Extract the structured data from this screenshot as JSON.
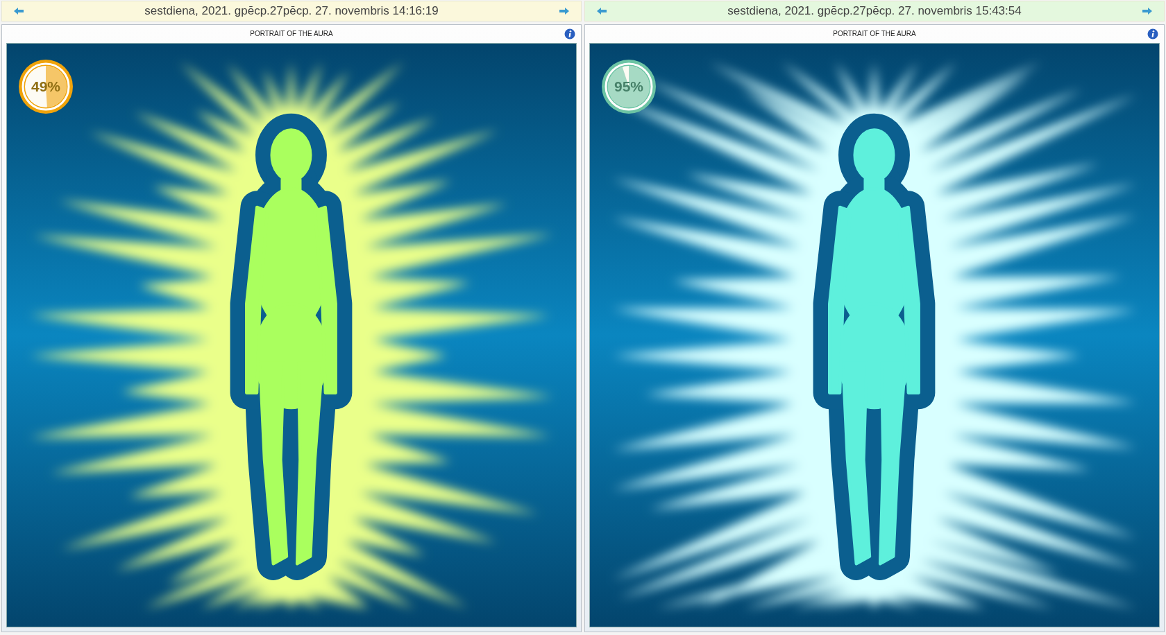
{
  "panels": [
    {
      "header": {
        "date": "sestdiena, 2021. gpēcp.27pēcp. 27. novembris 14:16:19",
        "color": "#fbf8dc"
      },
      "title": "PORTRAIT OF THE AURA",
      "badge": {
        "value": "49%",
        "level": 0.49,
        "color": "#f0a30a"
      },
      "aura": {
        "color": "#eaff8a"
      },
      "figure": {
        "color": "#aaff5e"
      }
    },
    {
      "header": {
        "date": "sestdiena, 2021. gpēcp.27pēcp. 27. novembris 15:43:54",
        "color": "#e4f8de"
      },
      "title": "PORTRAIT OF THE AURA",
      "badge": {
        "value": "95%",
        "level": 0.95,
        "color": "#6cc4a4"
      },
      "aura": {
        "color": "#d8ffff"
      },
      "figure": {
        "color": "#5ef0dc"
      }
    }
  ]
}
